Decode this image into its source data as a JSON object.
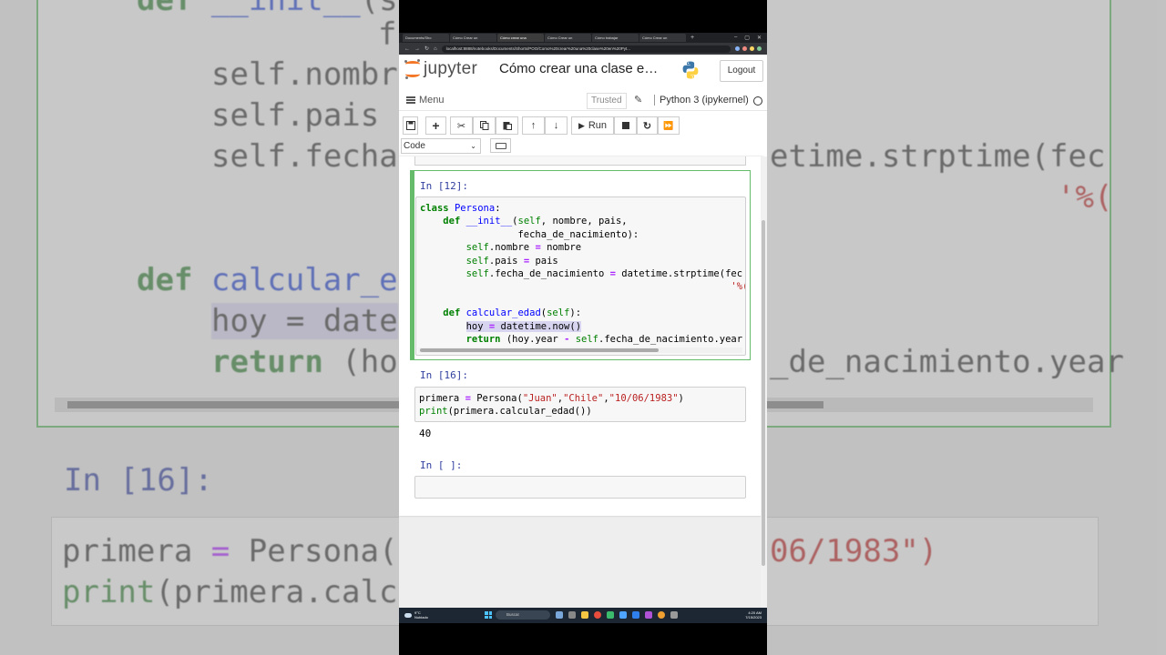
{
  "browser": {
    "tabs": [
      "Documents/Sho",
      "Cómo Crear un",
      "Cómo crear una",
      "Cómo Crear un",
      "Cómo trabajar",
      "Cómo Crear un"
    ],
    "active_tab": 2,
    "url": "localhost:8888/notebooks/Documents/Shorts/POO/Como%20crear%20una%20clase%20en%20Pyt..."
  },
  "header": {
    "logo_text": "jupyter",
    "notebook_title": "Cómo crear una clase e…",
    "logout_label": "Logout"
  },
  "menubar": {
    "menu_label": "Menu",
    "trusted_label": "Trusted",
    "kernel_label": "Python 3 (ipykernel)"
  },
  "toolbar": {
    "run_label": "Run",
    "cell_type": "Code"
  },
  "cells": [
    {
      "prompt": "In [12]:",
      "lines": [
        "class Persona:",
        "    def __init__(self, nombre, pais,",
        "                 fecha_de_nacimiento):",
        "        self.nombre = nombre",
        "        self.pais = pais",
        "        self.fecha_de_nacimiento = datetime.strptime(fec",
        "                                                      '%(",
        "",
        "    def calcular_edad(self):",
        "        hoy = datetime.now()",
        "        return (hoy.year - self.fecha_de_nacimiento.year"
      ]
    },
    {
      "prompt": "In [16]:",
      "lines": [
        "primera = Persona(\"Juan\",\"Chile\",\"10/06/1983\")",
        "print(primera.calcular_edad())"
      ],
      "output": "40"
    },
    {
      "prompt": "In [ ]:",
      "lines": []
    }
  ],
  "background": {
    "lines": [
      "def __init__(s",
      "         f",
      "  self.nombr",
      "  self.pais",
      "  self.fecha"
    ],
    "right_lines": [
      "etime.strptime(fec",
      "'%(",
      "_de_nacimiento.year"
    ],
    "lower_lines": [
      "def calcular_e",
      "    hoy = date",
      "    return (ho"
    ],
    "in16": "In [16]:",
    "bottom_lines": [
      "primera = Persona(",
      "print(primera.calc"
    ],
    "bottom_right": "06/1983\")"
  },
  "taskbar": {
    "weather_temp": "9°C",
    "weather_desc": "Nublado",
    "search_placeholder": "Buscar",
    "time": "4:20 AM",
    "date": "7/15/2023"
  },
  "colors": {
    "jupyter_orange": "#f37726",
    "prompt_blue": "#303f9f",
    "selected_green": "#66bb6a"
  }
}
